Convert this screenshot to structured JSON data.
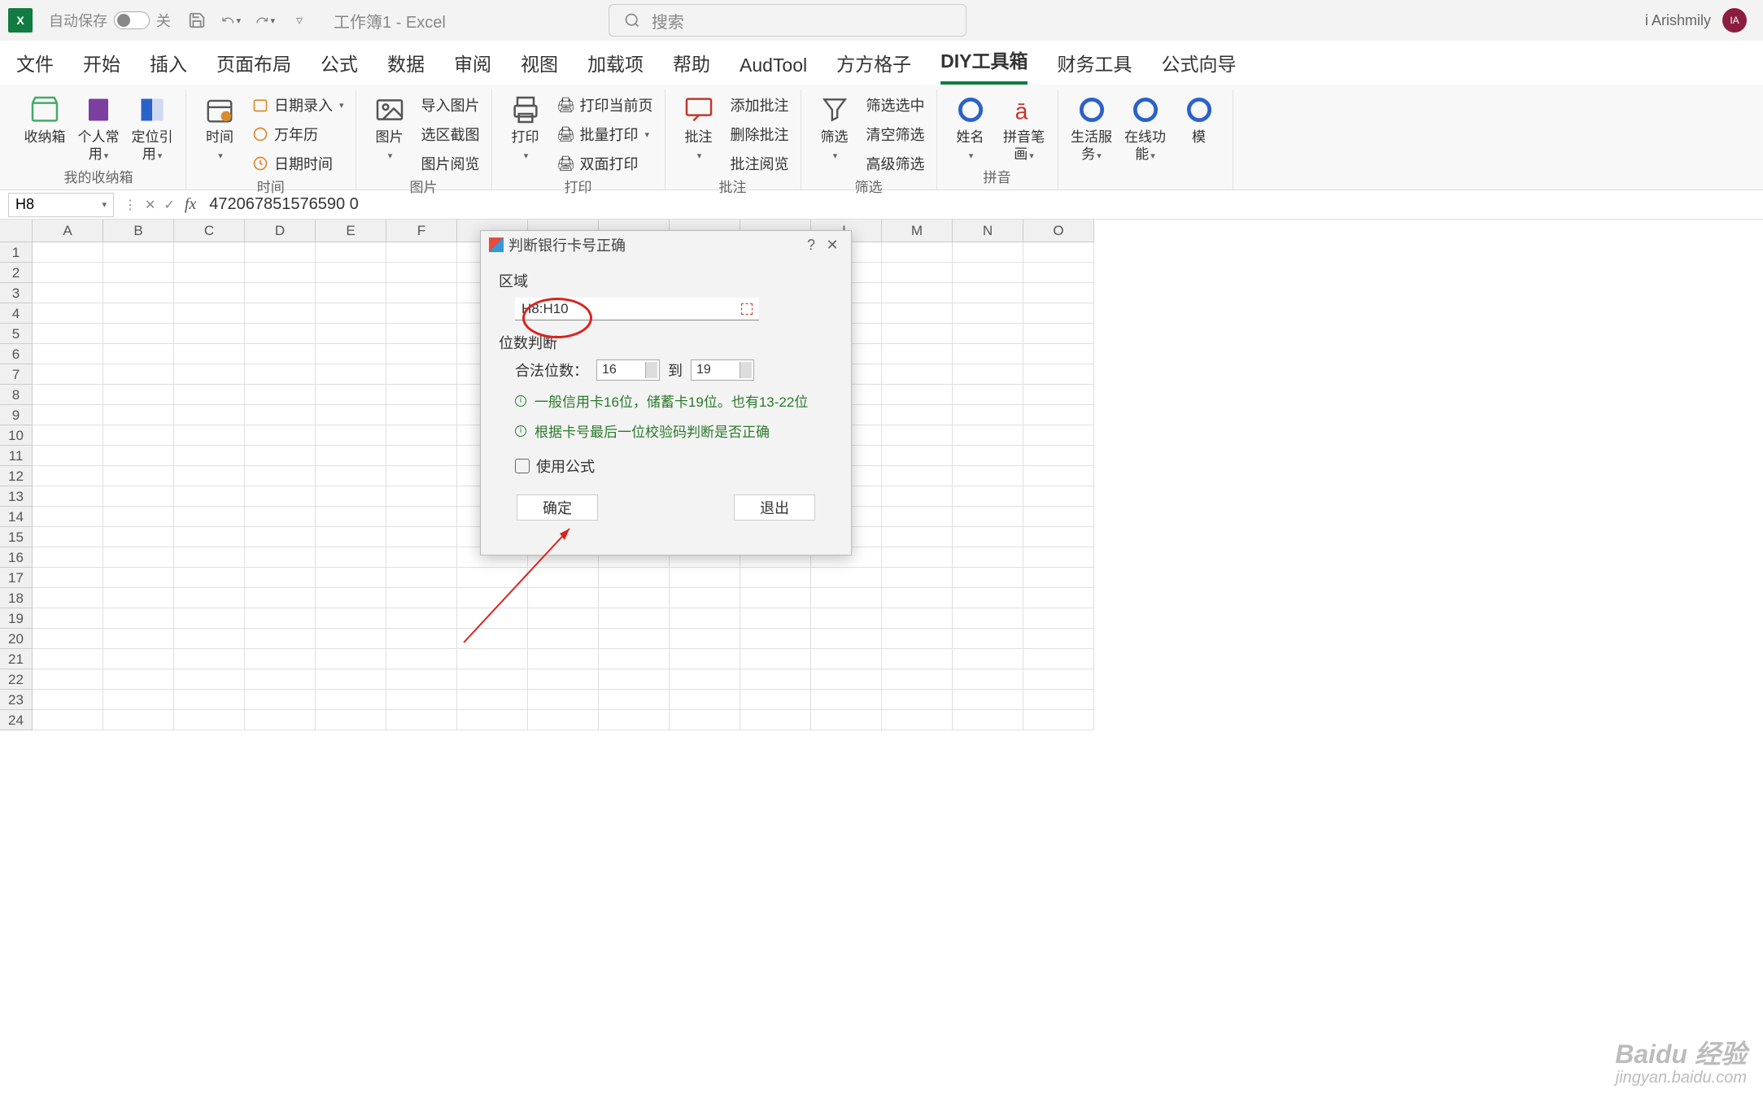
{
  "titlebar": {
    "autosave_label": "自动保存",
    "autosave_state": "关",
    "document_title": "工作簿1 - Excel",
    "search_placeholder": "搜索",
    "username": "i Arishmily",
    "avatar_initials": "IA"
  },
  "tabs": [
    "文件",
    "开始",
    "插入",
    "页面布局",
    "公式",
    "数据",
    "审阅",
    "视图",
    "加载项",
    "帮助",
    "AudTool",
    "方方格子",
    "DIY工具箱",
    "财务工具",
    "公式向导"
  ],
  "active_tab": "DIY工具箱",
  "ribbon": {
    "groups": [
      {
        "label": "我的收纳箱",
        "big": [
          {
            "name": "收纳箱"
          },
          {
            "name": "个人常用"
          },
          {
            "name": "定位引用"
          }
        ]
      },
      {
        "label": "时间",
        "big": [
          {
            "name": "时间"
          }
        ],
        "small": [
          "日期录入",
          "万年历",
          "日期时间"
        ]
      },
      {
        "label": "图片",
        "big": [
          {
            "name": "图片"
          }
        ],
        "small": [
          "导入图片",
          "选区截图",
          "图片阅览"
        ]
      },
      {
        "label": "打印",
        "big": [
          {
            "name": "打印"
          }
        ],
        "small": [
          "打印当前页",
          "批量打印",
          "双面打印"
        ]
      },
      {
        "label": "批注",
        "big": [
          {
            "name": "批注"
          }
        ],
        "small": [
          "添加批注",
          "删除批注",
          "批注阅览"
        ]
      },
      {
        "label": "筛选",
        "big": [
          {
            "name": "筛选"
          }
        ],
        "small": [
          "筛选选中",
          "清空筛选",
          "高级筛选"
        ]
      },
      {
        "label": "拼音",
        "big": [
          {
            "name": "姓名"
          },
          {
            "name": "拼音笔画"
          }
        ]
      },
      {
        "label": "",
        "big": [
          {
            "name": "生活服务"
          },
          {
            "name": "在线功能"
          },
          {
            "name": "模"
          }
        ]
      }
    ]
  },
  "formula_bar": {
    "cell_ref": "H8",
    "formula": "472067851576590 0"
  },
  "columns": [
    "A",
    "B",
    "C",
    "D",
    "E",
    "F",
    "",
    "",
    "",
    "",
    "",
    "L",
    "M",
    "N",
    "O"
  ],
  "rows": [
    "1",
    "2",
    "3",
    "4",
    "5",
    "6",
    "7",
    "8",
    "9",
    "10",
    "11",
    "12",
    "13",
    "14",
    "15",
    "16",
    "17",
    "18",
    "19",
    "20",
    "21",
    "22",
    "23",
    "24"
  ],
  "dialog": {
    "title": "判断银行卡号正确",
    "section_range": "区域",
    "range_value": "H8:H10",
    "section_digits": "位数判断",
    "legal_digits_label": "合法位数：",
    "min_digits": "16",
    "to_label": "到",
    "max_digits": "19",
    "info1": "一般信用卡16位，储蓄卡19位。也有13-22位",
    "info2": "根据卡号最后一位校验码判断是否正确",
    "use_formula_label": "使用公式",
    "ok": "确定",
    "cancel": "退出"
  },
  "watermark": {
    "main": "Baidu 经验",
    "sub": "jingyan.baidu.com"
  }
}
